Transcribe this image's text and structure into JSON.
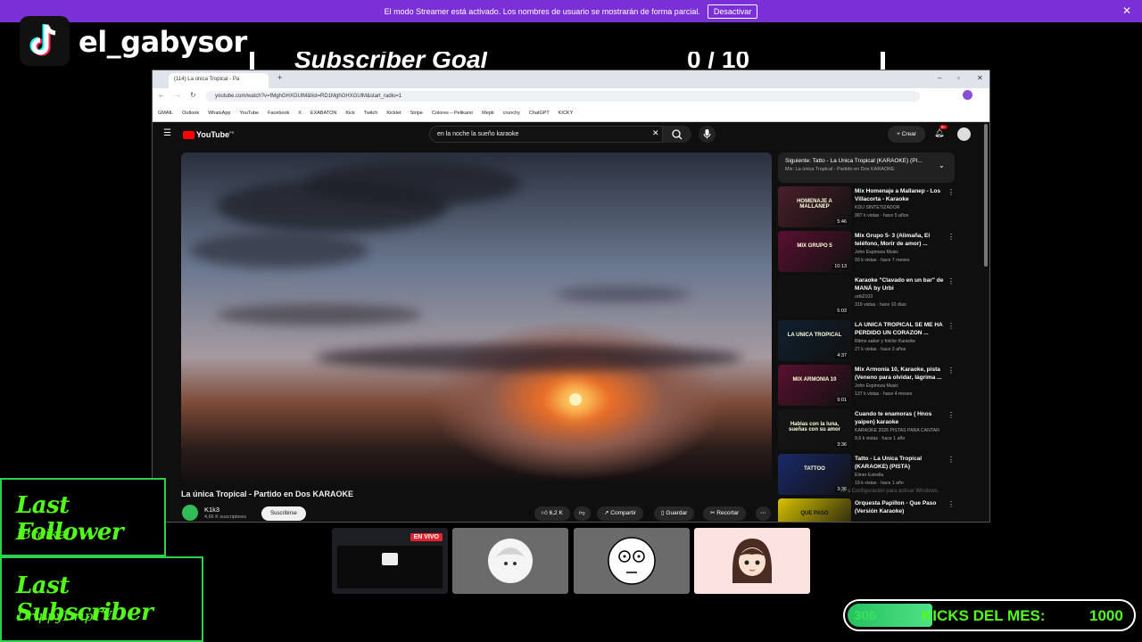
{
  "banner": {
    "message": "El modo Streamer está activado. Los nombres de usuario se mostrarán de forma parcial.",
    "button": "Desactivar",
    "close": "✕"
  },
  "overlay": {
    "channel_name": "el_gabysor",
    "goal_title": "Subscriber Goal",
    "goal_count": "0 / 10",
    "last_follower_label": "Last Follower",
    "last_follower_value": "lBraikel",
    "last_subscriber_label": "Last Subscriber",
    "last_subscriber_value": "DrippyDripTV",
    "live_badge": "EN VIVO",
    "kicks": {
      "count": "306",
      "label": "KICKS DEL MES:",
      "goal": "1000",
      "progress_fraction": 0.306
    },
    "accent": "#53fc18"
  },
  "browser": {
    "tab_title": "(114) La única Tropical - Pa",
    "url": "youtube.com/watch?v=fMghGHXGUlM&list=RD1MghGHXGUlM&start_radio=1",
    "bookmarks": [
      "GMAIL",
      "Outlook",
      "WhatsApp",
      "YouTube",
      "Facebook",
      "X",
      "EXABATON",
      "Kick",
      "Twitch",
      "Kicklet",
      "Stripe",
      "Colores – Pelikano",
      "Mepti",
      "crunchy",
      "ChatGPT",
      "KICKY"
    ]
  },
  "youtube": {
    "logo": "YouTube",
    "logo_region": "PE",
    "search_query": "en la noche la sueño karaoke",
    "create": "Crear",
    "notif_count": "9+",
    "video_title": "La única Tropical - Partido en Dos KARAOKE",
    "channel": "K1k3",
    "subs": "4,66 K suscriptores",
    "subscribe": "Suscribirse",
    "likes": "6,2 K",
    "share": "Compartir",
    "save": "Guardar",
    "clip": "Recortar",
    "more": "⋯",
    "next_title": "Siguiente: Tatto - La Unica Tropical (KARAOKE) (PI...",
    "next_sub": "Mix: La única Tropical - Partido en Dos KARAOKE",
    "recommendations": [
      {
        "title": "Mix Homenaje a Mallanep - Los Villacorta - Karaoke",
        "channel": "KDU SINTETIZADOR",
        "views": "987 k vistas · hace 5 años",
        "duration": "5:46",
        "color": "#4a1f2a"
      },
      {
        "title": "Mix Grupo 5- 3 (Alimaña, El teléfono, Morir de amor) ...",
        "channel": "John Espinoza Music",
        "views": "93 k vistas · hace 7 meses",
        "duration": "10:13",
        "color": "#5a1030"
      },
      {
        "title": "Karaoke \"Clavado en un bar\" de MANÁ by Urbi",
        "channel": "urbi2103",
        "views": "319 vistas · hace 10 días",
        "duration": "5:03",
        "color": "#111111"
      },
      {
        "title": "LA UNICA TROPICAL SE ME HA PERDIDO UN CORAZON ...",
        "channel": "Ritmo sabor y folclor Karaoke",
        "views": "27 k vistas · hace 2 años",
        "duration": "4:37",
        "color": "#102030"
      },
      {
        "title": "Mix Armonía 10, Karaoke, pista (Veneno para olvidar, lágrima ...",
        "channel": "John Espinoza Music",
        "views": "137 k vistas · hace 4 meses",
        "duration": "9:01",
        "color": "#5a1030"
      },
      {
        "title": "Cuando te enamoras ( Hnos yaipen) karaoke",
        "channel": "KARAOKE 2026 PISTAS PARA CANTAR",
        "views": "9,6 k vistas · hace 1 año",
        "duration": "3:36",
        "color": "#151515"
      },
      {
        "title": "Tatto - La Unica Tropical (KARAOKE) (PISTA)",
        "channel": "Elmer Estrella",
        "views": "19 k vistas · hace 1 año",
        "duration": "3:36",
        "color": "#1a2a6a"
      },
      {
        "title": "Orquesta Papillon - Que Paso (Versión Karaoke)",
        "channel": "",
        "views": "",
        "duration": "",
        "color": "#d8c200"
      }
    ],
    "rec_badges": [
      "HOMENAJE A MALLANEP",
      "MIX GRUPO 5",
      "",
      "LA UNICA TROPICAL",
      "MIX ARMONIA 10",
      "Hablas con la luna, sueñas con su amor",
      "TATTOO",
      "QUE PASO"
    ],
    "activate_windows": "Ve a Configuración para activar Windows."
  }
}
